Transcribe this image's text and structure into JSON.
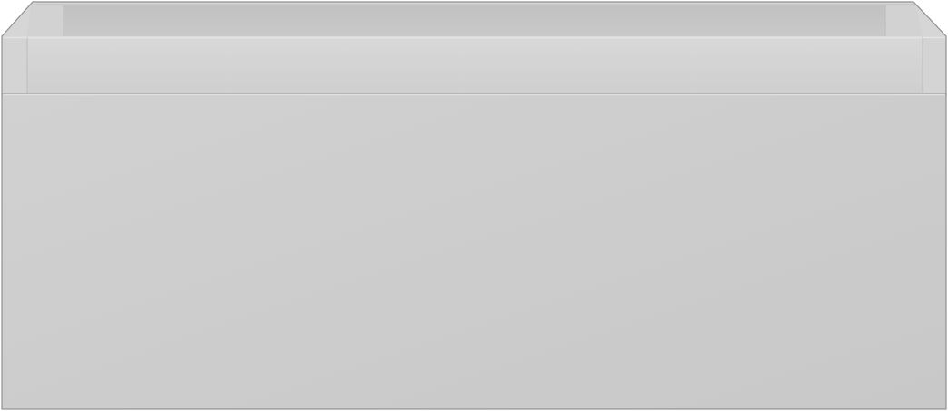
{
  "object": {
    "type": "drawer-unit",
    "colors": {
      "body": "#cbcbcb",
      "front_panel": "#cccccc",
      "rim_top": "#d6d6d6",
      "inner_back_wall": "#c6c6c6",
      "inner_side_wall": "#d2d2d2",
      "rail": "#d2d2d2",
      "edge_line": "#b9b9b9",
      "highlight": "#e2e2e2",
      "outline": "#8f8f8f"
    }
  }
}
